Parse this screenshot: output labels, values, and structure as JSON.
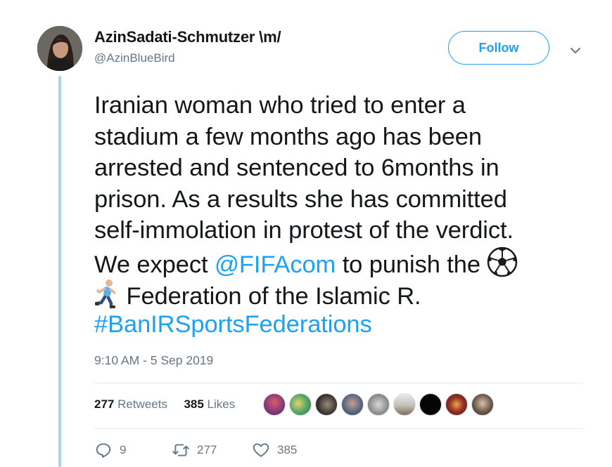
{
  "author": {
    "display_name": "AzinSadati-Schmutzer \\m/",
    "handle": "@AzinBlueBird"
  },
  "follow_button": {
    "label": "Follow"
  },
  "tweet": {
    "lines": [
      "Iranian woman who tried to enter a",
      "stadium a few months ago has been",
      "arrested and sentenced to 6months in",
      "prison. As a results she has committed",
      "self-immolation in protest of the verdict."
    ],
    "line6_prefix": "We expect ",
    "mention": "@FIFAcom",
    "line6_suffix": " to punish the ",
    "line7_text": " Federation of the Islamic R.",
    "hashtag": "#BanIRSportsFederations",
    "emojis": [
      "soccer-ball-icon",
      "person-running-icon"
    ]
  },
  "timestamp": "9:10 AM - 5 Sep 2019",
  "stats": {
    "retweets_count": "277",
    "retweets_label": " Retweets",
    "likes_count": "385",
    "likes_label": " Likes"
  },
  "liked_by_avatars": 9,
  "actions": {
    "reply_count": "9",
    "retweet_count": "277",
    "like_count": "385"
  },
  "colors": {
    "accent": "#1da1f2",
    "text": "#14171a",
    "secondary": "#657786",
    "thread_line": "#a9d3f5",
    "divider": "#e6ecf0"
  }
}
